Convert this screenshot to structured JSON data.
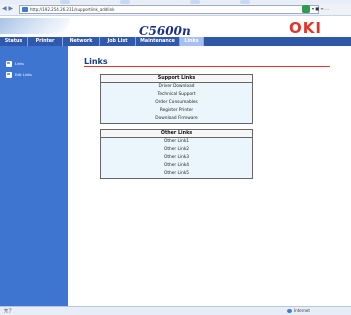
{
  "browser": {
    "nav": "◀ ▶",
    "url": "http://192.254.26.211/supportlink_addlink",
    "tools": "▾ ■ ≡ …"
  },
  "header": {
    "model": "C5600n",
    "brand": "OKI"
  },
  "tabs": [
    {
      "label": "Status",
      "active": false
    },
    {
      "label": "Printer",
      "active": false
    },
    {
      "label": "Network",
      "active": false
    },
    {
      "label": "Job List",
      "active": false
    },
    {
      "label": "Maintenance",
      "active": false
    },
    {
      "label": "Links",
      "active": true
    }
  ],
  "sidebar": {
    "items": [
      {
        "label": "Links"
      },
      {
        "label": "Edit Links"
      }
    ]
  },
  "main": {
    "title": "Links",
    "support_header": "Support Links",
    "support_links": [
      "Driver Download",
      "Technical Support",
      "Order Consumables",
      "Register Printer",
      "Download Firmware"
    ],
    "other_header": "Other Links",
    "other_links": [
      "Other Link1",
      "Other Link2",
      "Other Link3",
      "Other Link4",
      "Other Link5"
    ]
  },
  "status": {
    "left": "完了",
    "right": "Internet"
  }
}
